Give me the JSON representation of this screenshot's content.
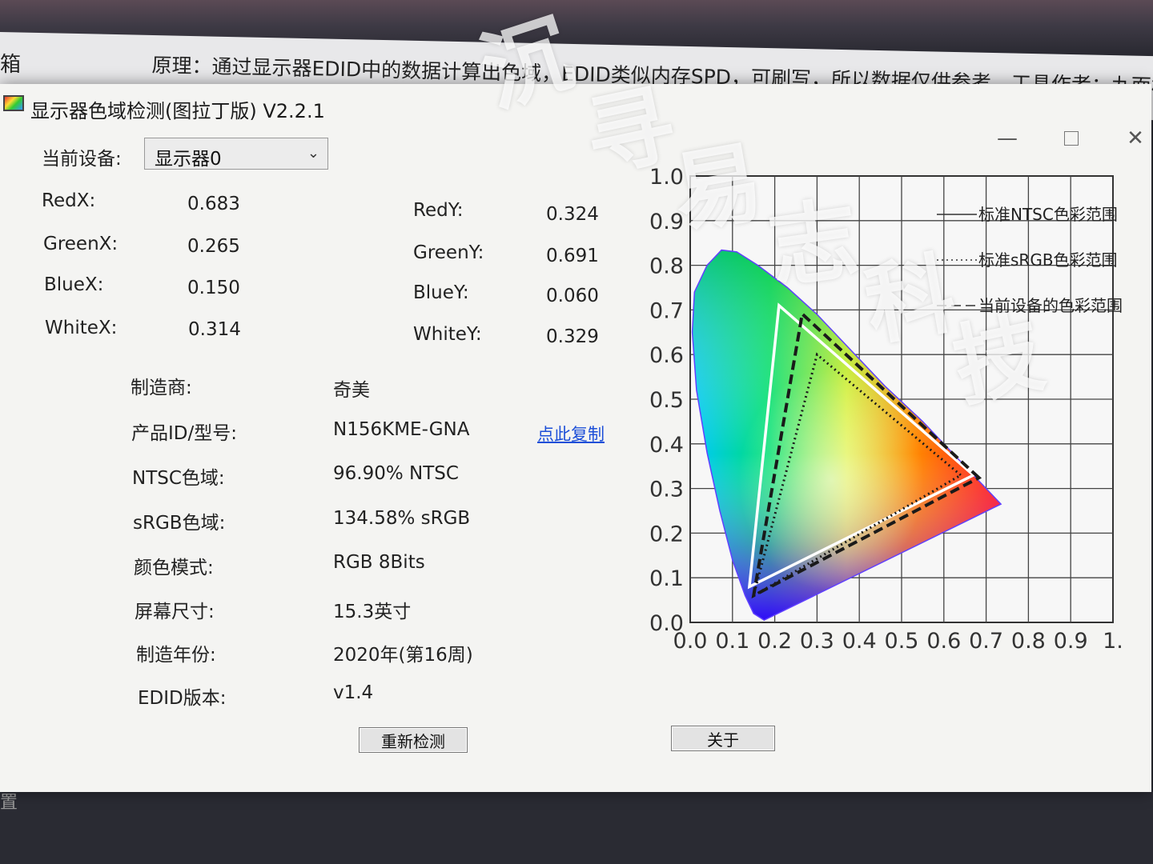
{
  "background": {
    "strip_text": "原理：通过显示器EDID中的数据计算出色域，EDID类似内存SPD，可刷写，所以数据仅供参考。工具作者：九面相",
    "left_edge_char": "箱",
    "left_edge_char_2": "置"
  },
  "window": {
    "title": "显示器色域检测(图拉丁版) V2.2.1",
    "controls": {
      "minimize": "—",
      "close": "✕"
    }
  },
  "device": {
    "label": "当前设备:",
    "selected": "显示器0",
    "chevron": "⌄"
  },
  "coords": {
    "red_x": {
      "label": "RedX:",
      "value": "0.683"
    },
    "green_x": {
      "label": "GreenX:",
      "value": "0.265"
    },
    "blue_x": {
      "label": "BlueX:",
      "value": "0.150"
    },
    "white_x": {
      "label": "WhiteX:",
      "value": "0.314"
    },
    "red_y": {
      "label": "RedY:",
      "value": "0.324"
    },
    "green_y": {
      "label": "GreenY:",
      "value": "0.691"
    },
    "blue_y": {
      "label": "BlueY:",
      "value": "0.060"
    },
    "white_y": {
      "label": "WhiteY:",
      "value": "0.329"
    }
  },
  "info": {
    "manufacturer": {
      "label": "制造商:",
      "value": "奇美"
    },
    "product_id": {
      "label": "产品ID/型号:",
      "value": "N156KME-GNA"
    },
    "copy_link": "点此复制",
    "ntsc": {
      "label": "NTSC色域:",
      "value": "96.90% NTSC"
    },
    "srgb": {
      "label": "sRGB色域:",
      "value": "134.58% sRGB"
    },
    "color_mode": {
      "label": "颜色模式:",
      "value": "RGB 8Bits"
    },
    "screen_size": {
      "label": "屏幕尺寸:",
      "value": "15.3英寸"
    },
    "year": {
      "label": "制造年份:",
      "value": "2020年(第16周)"
    },
    "edid": {
      "label": "EDID版本:",
      "value": "v1.4"
    }
  },
  "buttons": {
    "redetect": "重新检测",
    "about": "关于"
  },
  "chart_data": {
    "type": "scatter",
    "x_ticks": [
      "0.0",
      "0.1",
      "0.2",
      "0.3",
      "0.4",
      "0.5",
      "0.6",
      "0.7",
      "0.8",
      "0.9",
      "1."
    ],
    "y_ticks": [
      "0.0",
      "0.1",
      "0.2",
      "0.3",
      "0.4",
      "0.5",
      "0.6",
      "0.7",
      "0.8",
      "0.9",
      "1.0"
    ],
    "xlim": [
      0,
      1
    ],
    "ylim": [
      0,
      1
    ],
    "grid": true,
    "legend": [
      {
        "name": "标准NTSC色彩范围",
        "style": "solid",
        "color": "#ffffff"
      },
      {
        "name": "标准sRGB色彩范围",
        "style": "dotted",
        "color": "#222222"
      },
      {
        "name": "当前设备的色彩范围",
        "style": "dashed",
        "color": "#222222"
      }
    ],
    "series": [
      {
        "name": "标准NTSC色彩范围",
        "points": [
          [
            0.67,
            0.33
          ],
          [
            0.21,
            0.71
          ],
          [
            0.14,
            0.08
          ]
        ]
      },
      {
        "name": "标准sRGB色彩范围",
        "points": [
          [
            0.64,
            0.33
          ],
          [
            0.3,
            0.6
          ],
          [
            0.15,
            0.06
          ]
        ]
      },
      {
        "name": "当前设备的色彩范围",
        "points": [
          [
            0.683,
            0.324
          ],
          [
            0.265,
            0.691
          ],
          [
            0.15,
            0.06
          ]
        ]
      }
    ]
  },
  "watermark_chars": [
    "沉",
    "寻",
    "易",
    "志",
    "科",
    "技"
  ]
}
